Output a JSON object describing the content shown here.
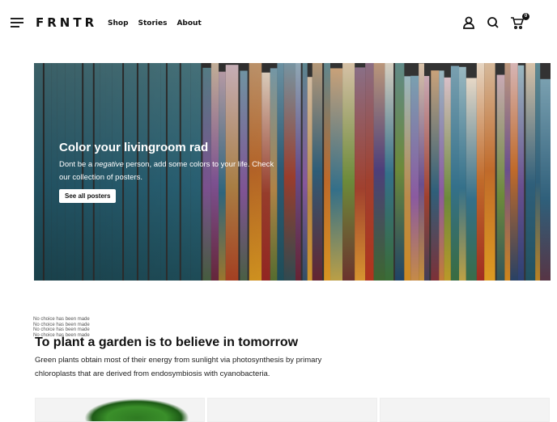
{
  "header": {
    "logo": "FRNTR",
    "nav": [
      "Shop",
      "Stories",
      "About"
    ],
    "cart_count": "0",
    "icons": [
      "menu-icon",
      "user-icon",
      "search-icon",
      "cart-icon"
    ]
  },
  "hero": {
    "title": "Color your livingroom rad",
    "text_before": "Dont be a ",
    "text_em": "negative",
    "text_after": " person, add some colors to your life. Check our collection of posters.",
    "button": "See all posters"
  },
  "notes": [
    "No choice has been made",
    "No choice has been made",
    "No choice has been made",
    "No choice has been made"
  ],
  "section": {
    "title": "To plant a garden is to believe in tomorrow",
    "text": "Green plants obtain most of their energy from sunlight via photosynthesis by primary chloroplasts that are derived from endosymbiosis with cyanobacteria."
  }
}
